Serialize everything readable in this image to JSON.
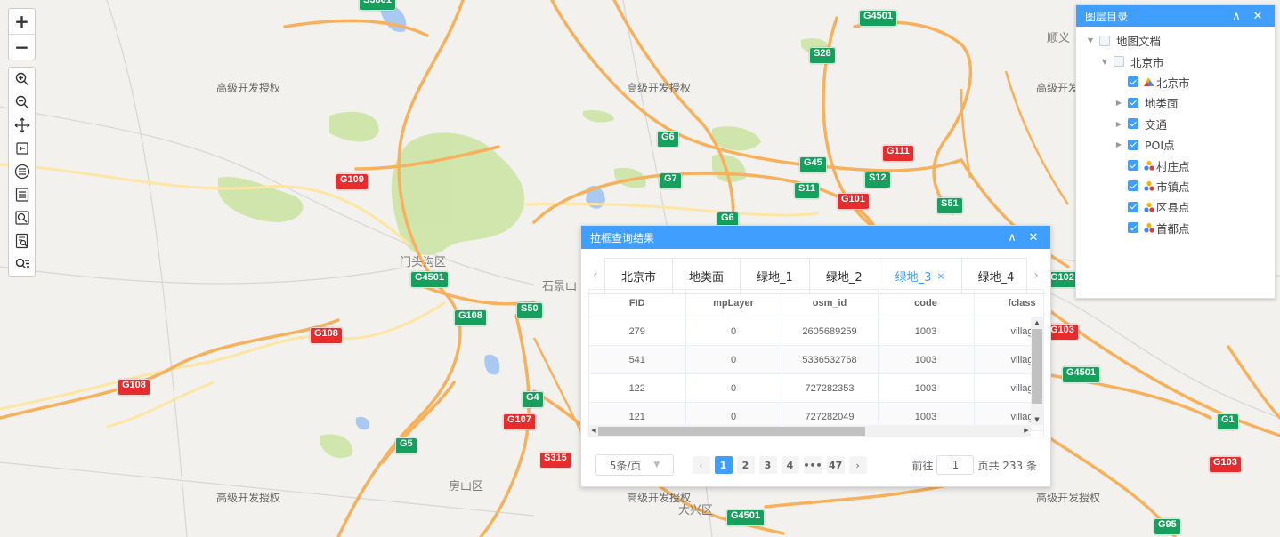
{
  "map": {
    "watermark": "高级开发授权",
    "places": [
      "门头沟区",
      "石景山",
      "房山区",
      "大兴区",
      "顺义"
    ],
    "shields": [
      {
        "t": "G4501",
        "c": "g"
      },
      {
        "t": "S28",
        "c": "g"
      },
      {
        "t": "G6",
        "c": "g"
      },
      {
        "t": "G111",
        "c": "r"
      },
      {
        "t": "G45",
        "c": "g"
      },
      {
        "t": "G109",
        "c": "r"
      },
      {
        "t": "G7",
        "c": "g"
      },
      {
        "t": "S11",
        "c": "g"
      },
      {
        "t": "S12",
        "c": "g"
      },
      {
        "t": "G101",
        "c": "r"
      },
      {
        "t": "S51",
        "c": "g"
      },
      {
        "t": "G6",
        "c": "g"
      },
      {
        "t": "G4501",
        "c": "g"
      },
      {
        "t": "G108",
        "c": "g"
      },
      {
        "t": "S50",
        "c": "g"
      },
      {
        "t": "G108",
        "c": "r"
      },
      {
        "t": "G108",
        "c": "r"
      },
      {
        "t": "G4",
        "c": "g"
      },
      {
        "t": "G107",
        "c": "r"
      },
      {
        "t": "G5",
        "c": "g"
      },
      {
        "t": "S315",
        "c": "r"
      },
      {
        "t": "G4501",
        "c": "g"
      },
      {
        "t": "G102",
        "c": "g"
      },
      {
        "t": "G103",
        "c": "r"
      },
      {
        "t": "G4501",
        "c": "g"
      },
      {
        "t": "G1",
        "c": "g"
      },
      {
        "t": "G103",
        "c": "r"
      },
      {
        "t": "G95",
        "c": "g"
      },
      {
        "t": "S3801",
        "c": "g"
      }
    ]
  },
  "toolbar": {
    "zoom_in": "+",
    "zoom_out": "−",
    "tools": [
      "zoom-in-icon",
      "zoom-out-icon",
      "pan-icon",
      "back-icon",
      "list-circle-icon",
      "list-icon",
      "query-icon",
      "attribute-query-icon",
      "search-filter-icon"
    ]
  },
  "layer_panel": {
    "title": "图层目录",
    "minimize": "∧",
    "close": "✕",
    "nodes": [
      {
        "label": "地图文档",
        "level": 0,
        "arrow": "▼",
        "check": "off",
        "icon": ""
      },
      {
        "label": "北京市",
        "level": 1,
        "arrow": "▼",
        "check": "off",
        "icon": ""
      },
      {
        "label": "北京市",
        "level": 2,
        "arrow": "",
        "check": "on",
        "icon": "area"
      },
      {
        "label": "地类面",
        "level": 2,
        "arrow": "▶",
        "check": "on",
        "icon": ""
      },
      {
        "label": "交通",
        "level": 2,
        "arrow": "▶",
        "check": "on",
        "icon": ""
      },
      {
        "label": "POI点",
        "level": 2,
        "arrow": "▶",
        "check": "on",
        "icon": ""
      },
      {
        "label": "村庄点",
        "level": 2,
        "arrow": "",
        "check": "on",
        "icon": "point"
      },
      {
        "label": "市镇点",
        "level": 2,
        "arrow": "",
        "check": "on",
        "icon": "point"
      },
      {
        "label": "区县点",
        "level": 2,
        "arrow": "",
        "check": "on",
        "icon": "point"
      },
      {
        "label": "首都点",
        "level": 2,
        "arrow": "",
        "check": "on",
        "icon": "point"
      }
    ]
  },
  "result_panel": {
    "title": "拉框查询结果",
    "minimize": "∧",
    "close": "✕",
    "tab_prev": "‹",
    "tab_next": "›",
    "tabs": [
      {
        "label": "北京市",
        "active": false
      },
      {
        "label": "地类面",
        "active": false
      },
      {
        "label": "绿地_1",
        "active": false
      },
      {
        "label": "绿地_2",
        "active": false
      },
      {
        "label": "绿地_3",
        "active": true
      },
      {
        "label": "绿地_4",
        "active": false
      }
    ],
    "tab_close": "×",
    "columns": [
      "FID",
      "mpLayer",
      "osm_id",
      "code",
      "fclass"
    ],
    "rows": [
      [
        "279",
        "0",
        "2605689259",
        "1003",
        "villag"
      ],
      [
        "541",
        "0",
        "5336532768",
        "1003",
        "villag"
      ],
      [
        "122",
        "0",
        "727282353",
        "1003",
        "villag"
      ],
      [
        "121",
        "0",
        "727282049",
        "1003",
        "villag"
      ]
    ],
    "pager": {
      "page_size": "5条/页",
      "pages": [
        "1",
        "2",
        "3",
        "4",
        "•••",
        "47"
      ],
      "current": "1",
      "goto_label": "前往",
      "goto_value": "1",
      "total": "页共 233 条"
    }
  }
}
